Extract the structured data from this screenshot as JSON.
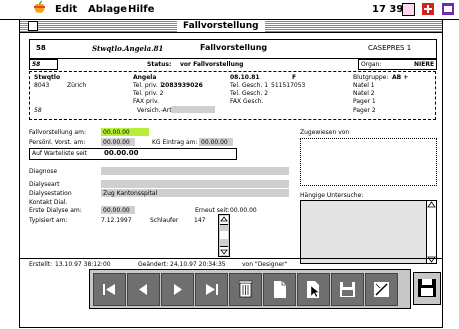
{
  "menubar": {
    "edit": "Edit",
    "ablage": "Ablage",
    "hilfe": "Hilfe",
    "time": "17 39"
  },
  "window": {
    "title": "Fallvorstellung"
  },
  "header": {
    "id": "58",
    "name": "Stwqtlo.Angela.81",
    "title": "Fallvorstellung",
    "code": "CASEPRES 1"
  },
  "status_row": {
    "id": "58",
    "status_label": "Status:",
    "status_value": "vor Fallvorstellung",
    "organ_label": "Organ:",
    "organ_value": "NIERE"
  },
  "patient": {
    "surname": "Stwqtlo",
    "firstname": "Angela",
    "dob": "08.10.81",
    "sex": "F",
    "blood_label": "Blutgruppe:",
    "blood_value": "AB +",
    "zip": "8043",
    "city": "Zürich",
    "tel_priv1_label": "Tel. priv. 1",
    "tel_priv1_value": "2083939026",
    "tel_priv2_label": "Tel. priv. 2",
    "fax_priv_label": "FAX priv.",
    "tel_gesch1_label": "Tel. Gesch. 1",
    "tel_gesch1_value": "511517053",
    "tel_gesch2_label": "Tel. Gesch. 2",
    "fax_gesch_label": "FAX Gesch.",
    "natel1": "Natel 1",
    "natel2": "Natel 2",
    "pager1": "Pager 1",
    "pager2": "Pager 2",
    "id": "58",
    "vers_label": "Versich.-Art"
  },
  "form": {
    "fallvorstellung_label": "Fallvorstellung am:",
    "fallvorstellung_value": "00.00.00",
    "pers_vorst_label": "Persönl. Vorst. am:",
    "pers_vorst_value": "00.00.00",
    "kg_label": "KG Eintrag am:",
    "kg_value": "00.00.00",
    "warteliste_label": "Auf Warteliste seit",
    "warteliste_value": "00.00.00",
    "diagnose_label": "Diagnose",
    "dialyseart_label": "Dialyseart",
    "dialysestation_label": "Dialysestation",
    "dialysestation_value": "Zug Kantonsspital",
    "kontakt_label": "Kontakt Dial.",
    "erste_dialyse_label": "Erste Dialyse am:",
    "erste_dialyse_value": "00.00.00",
    "erneut_label": "Erneut seit:",
    "erneut_value": "00.00.00",
    "typisiert_label": "Typisiert am:",
    "typisiert_value": "7.12.1997",
    "schlaufer_label": "Schlaufer",
    "schlaufer_value": "147",
    "zugewiesen_label": "Zugewiesen von",
    "haengige_label": "Hängige Untersuche:"
  },
  "footer": {
    "erstellt_label": "Erstellt:",
    "erstellt_value": "13.10.97 38:12:00",
    "geaendert_label": "Geändert:",
    "geaendert_value": "24.10.97 20:34:35",
    "von_label": "von \"Designer\""
  }
}
